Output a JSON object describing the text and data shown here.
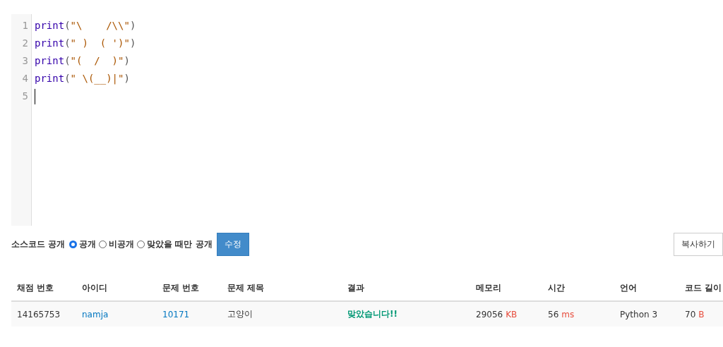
{
  "editor": {
    "lines": [
      {
        "number": "1",
        "tokens": [
          {
            "kind": "builtin",
            "text": "print"
          },
          {
            "kind": "bracket",
            "text": "("
          },
          {
            "kind": "string",
            "text": "\"\\    /\\\\\""
          },
          {
            "kind": "bracket",
            "text": ")"
          }
        ]
      },
      {
        "number": "2",
        "tokens": [
          {
            "kind": "builtin",
            "text": "print"
          },
          {
            "kind": "bracket",
            "text": "("
          },
          {
            "kind": "string",
            "text": "\" )  ( ')\""
          },
          {
            "kind": "bracket",
            "text": ")"
          }
        ]
      },
      {
        "number": "3",
        "tokens": [
          {
            "kind": "builtin",
            "text": "print"
          },
          {
            "kind": "bracket",
            "text": "("
          },
          {
            "kind": "string",
            "text": "\"(  /  )\""
          },
          {
            "kind": "bracket",
            "text": ")"
          }
        ]
      },
      {
        "number": "4",
        "tokens": [
          {
            "kind": "builtin",
            "text": "print"
          },
          {
            "kind": "bracket",
            "text": "("
          },
          {
            "kind": "string",
            "text": "\" \\(__)|\""
          },
          {
            "kind": "bracket",
            "text": ")"
          }
        ]
      },
      {
        "number": "5",
        "cursor": true
      }
    ]
  },
  "visibility": {
    "label": "소스코드 공개",
    "options": [
      {
        "label": "공개",
        "selected": true
      },
      {
        "label": "비공개",
        "selected": false
      },
      {
        "label": "맞았을 때만 공개",
        "selected": false
      }
    ],
    "submit": "수정",
    "copy": "복사하기"
  },
  "table": {
    "columns": [
      "채점 번호",
      "아이디",
      "문제 번호",
      "문제 제목",
      "결과",
      "메모리",
      "시간",
      "언어",
      "코드 길이"
    ],
    "rows": [
      {
        "cells": [
          {
            "kind": "plain",
            "text": "14165753"
          },
          {
            "kind": "link",
            "text": "namja"
          },
          {
            "kind": "link",
            "text": "10171"
          },
          {
            "kind": "plain",
            "text": "고양이"
          },
          {
            "kind": "result",
            "text": "맞았습니다!!"
          },
          {
            "kind": "unit",
            "text": "29056",
            "unit": "KB"
          },
          {
            "kind": "unit",
            "text": "56",
            "unit": "ms"
          },
          {
            "kind": "plain",
            "text": "Python 3"
          },
          {
            "kind": "unit",
            "text": "70",
            "unit": "B"
          }
        ]
      }
    ]
  }
}
